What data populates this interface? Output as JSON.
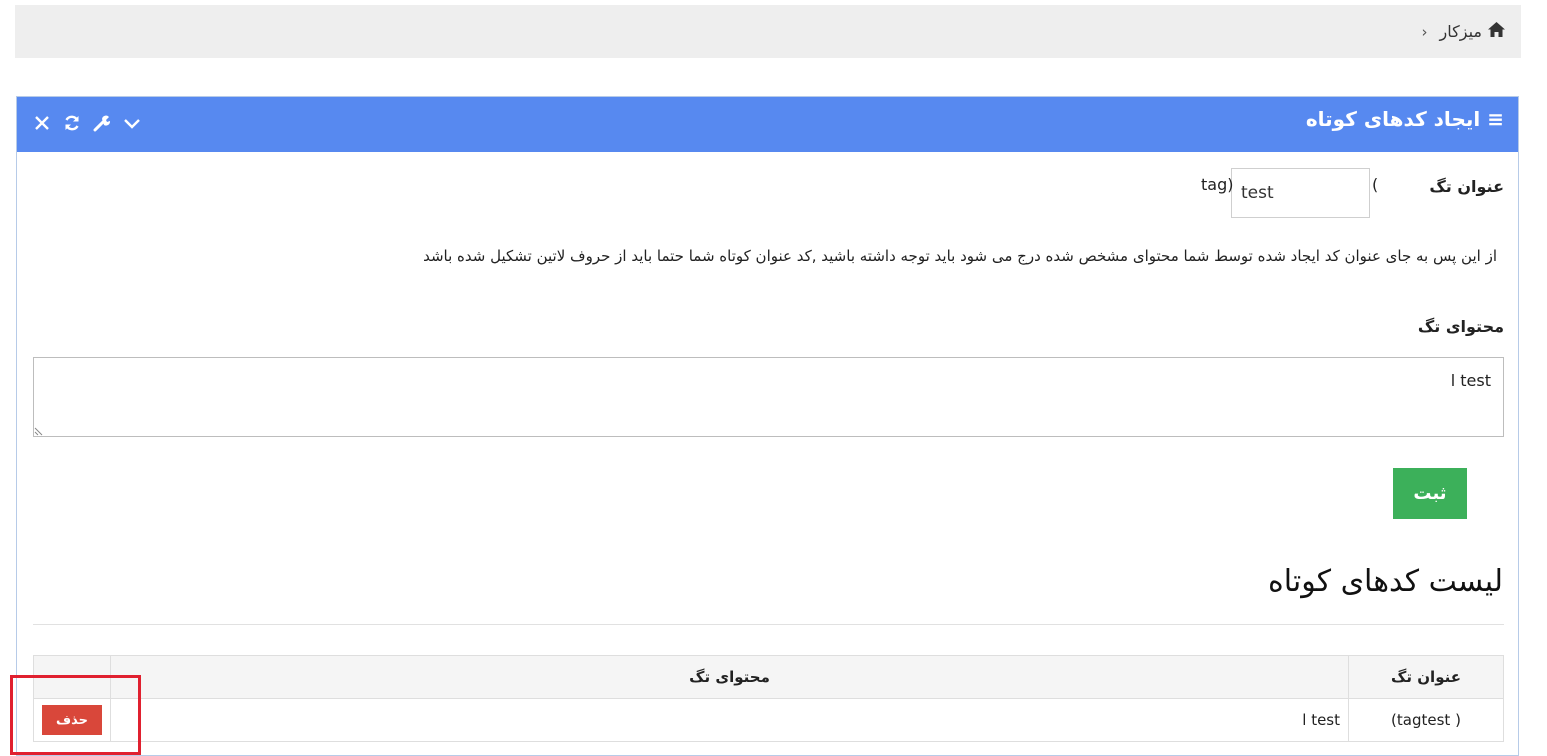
{
  "breadcrumb": {
    "home_label": "میزکار",
    "separator": "‹"
  },
  "widget": {
    "title": "ایجاد کدهای کوتاه",
    "tools": [
      "close-icon",
      "refresh-icon",
      "wrench-icon",
      "chevron-down-icon"
    ],
    "header_color": "#5789f0"
  },
  "form": {
    "title_label": "عنوان تگ",
    "title_prefix": "(",
    "title_suffix": "tag)",
    "title_value": "test",
    "hint": "از این پس به جای عنوان کد ایجاد شده توسط شما محتوای مشخص شده درج می شود باید توجه داشته باشید ,کد عنوان کوتاه شما حتما باید از حروف لاتین تشکیل شده باشد",
    "content_label": "محتوای تگ",
    "content_value": "test ا",
    "submit_label": "ثبت",
    "submit_color": "#3cb05a"
  },
  "list": {
    "heading": "لیست کدهای کوتاه",
    "columns": {
      "title": "عنوان تگ",
      "content": "محتوای تگ",
      "actions": ""
    },
    "rows": [
      {
        "title": "( tagtest)",
        "content": "test ا",
        "delete_label": "حذف"
      }
    ],
    "delete_color": "#d9473a"
  },
  "annotation": {
    "highlight_color": "#e0202f"
  }
}
